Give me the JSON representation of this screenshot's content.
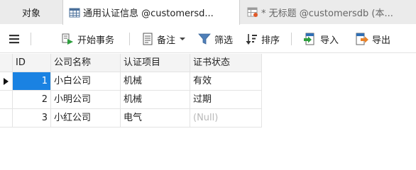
{
  "tabs": {
    "objects": "对象",
    "active": "通用认证信息 @customersd...",
    "inactive": "* 无标题 @customersdb (本..."
  },
  "toolbar": {
    "menu_icon": "hamburger-menu-icon",
    "begin_transaction": "开始事务",
    "note": "备注",
    "filter": "筛选",
    "sort": "排序",
    "import": "导入",
    "export": "导出"
  },
  "table": {
    "columns": [
      "ID",
      "公司名称",
      "认证项目",
      "证书状态"
    ],
    "rows": [
      {
        "id": "1",
        "company": "小白公司",
        "item": "机械",
        "status": "有效"
      },
      {
        "id": "2",
        "company": "小明公司",
        "item": "机械",
        "status": "过期"
      },
      {
        "id": "3",
        "company": "小红公司",
        "item": "电气",
        "status": "(Null)"
      }
    ]
  },
  "colors": {
    "selection": "#1a82e2",
    "accent_green": "#2e9e3e",
    "accent_orange": "#e8822a",
    "accent_blue": "#2f6fb5"
  }
}
